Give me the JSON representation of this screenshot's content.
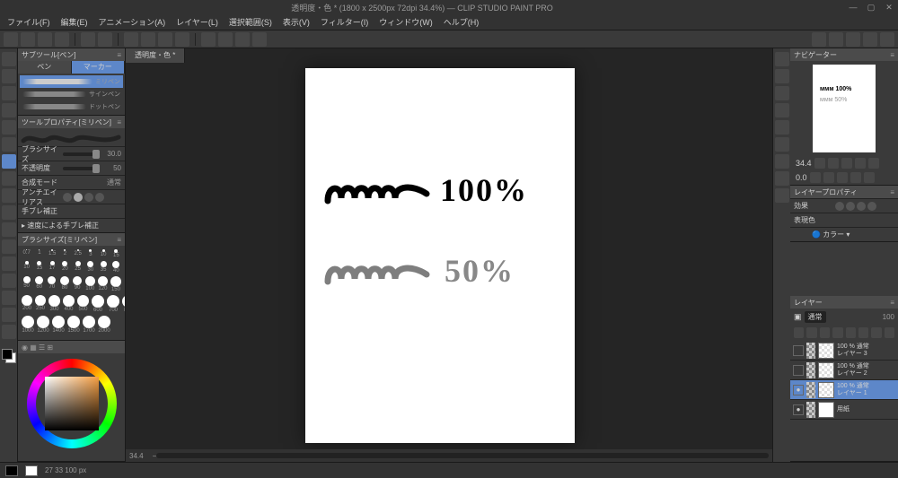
{
  "title": "透明度・色 * (1800 x 2500px 72dpi 34.4%) — CLIP STUDIO PAINT PRO",
  "menu": [
    "ファイル(F)",
    "編集(E)",
    "アニメーション(A)",
    "レイヤー(L)",
    "選択範囲(S)",
    "表示(V)",
    "フィルター(I)",
    "ウィンドウ(W)",
    "ヘルプ(H)"
  ],
  "doc_tab": "透明度・色 *",
  "subtool": {
    "title": "サブツール[ペン]",
    "tabs": [
      "ペン",
      "マーカー"
    ],
    "active_tab": 1,
    "items": [
      {
        "name": "ミリペン",
        "sel": true
      },
      {
        "name": "サインペン",
        "sel": false
      },
      {
        "name": "ドットペン",
        "sel": false
      }
    ]
  },
  "toolprop": {
    "title": "ツールプロパティ[ミリペン]",
    "rows": [
      {
        "label": "ブラシサイズ",
        "value": "30.0"
      },
      {
        "label": "不透明度",
        "value": "50"
      },
      {
        "label": "合成モード",
        "value": "通常"
      },
      {
        "label": "アンチエイリアス"
      },
      {
        "label": "手ブレ補正"
      },
      {
        "label": "速度による手ブレ補正"
      }
    ]
  },
  "brushsize": {
    "title": "ブラシサイズ[ミリペン]",
    "labels_a": [
      "0.7",
      "1",
      "1.5",
      "2",
      "2.5",
      "3",
      "10",
      "15"
    ],
    "labels_b": [
      "10",
      "15",
      "17",
      "20",
      "25",
      "30",
      "35",
      "40"
    ],
    "labels_c": [
      "50",
      "60",
      "70",
      "80",
      "90",
      "100",
      "120",
      "150"
    ],
    "labels_d": [
      "200",
      "250",
      "300",
      "400",
      "500",
      "600",
      "700",
      "800"
    ],
    "labels_e": [
      "1000",
      "1200",
      "1400",
      "1500",
      "1700",
      "2000"
    ]
  },
  "canvas": {
    "line1": "100%",
    "line2": "50%",
    "zoom": "34.4"
  },
  "navigator": {
    "title": "ナビゲーター",
    "zoom": "34.4",
    "angle": "0.0"
  },
  "layerprop": {
    "title": "レイヤープロパティ",
    "effects_label": "効果",
    "color_label": "表現色",
    "color_value": "カラー"
  },
  "layers": {
    "title": "レイヤー",
    "blend": "通常",
    "opacity": "100",
    "toolrow_icons": 8,
    "items": [
      {
        "op": "100 % 通常",
        "name": "レイヤー 3",
        "sel": false,
        "visible": false,
        "chk": true
      },
      {
        "op": "100 % 通常",
        "name": "レイヤー 2",
        "sel": false,
        "visible": false,
        "chk": true
      },
      {
        "op": "100 % 通常",
        "name": "レイヤー 1",
        "sel": true,
        "visible": true,
        "chk": true
      },
      {
        "op": "",
        "name": "用紙",
        "sel": false,
        "visible": true,
        "chk": false
      }
    ]
  },
  "status": {
    "pos": "27 33 100 px"
  }
}
